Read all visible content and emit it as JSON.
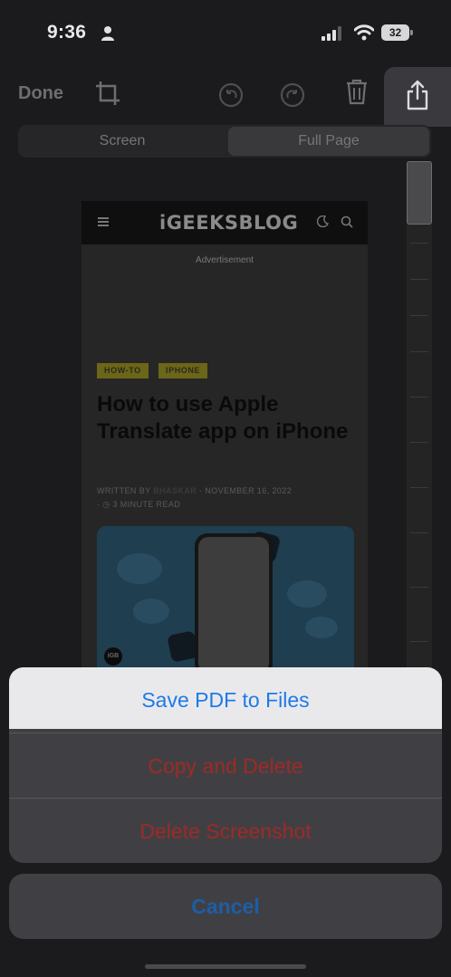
{
  "status_bar": {
    "time": "9:36",
    "battery": "32"
  },
  "toolbar": {
    "done_label": "Done"
  },
  "segments": {
    "screen": "Screen",
    "full_page": "Full Page"
  },
  "article": {
    "logo": "iGEEKSBLOG",
    "advertisement": "Advertisement",
    "tags": [
      "HOW-TO",
      "IPHONE"
    ],
    "headline": "How to use Apple Translate app on iPhone",
    "written_by": "WRITTEN BY",
    "author": "BHASKAR",
    "date": "NOVEMBER 16, 2022",
    "read_time": "3 MINUTE READ",
    "badge": "iGB"
  },
  "action_sheet": {
    "save_pdf": "Save PDF to Files",
    "copy_delete": "Copy and Delete",
    "delete_screenshot": "Delete Screenshot",
    "cancel": "Cancel"
  },
  "colors": {
    "action_blue": "#1f7ae6",
    "destructive_red": "#9e2a26",
    "tag_yellow": "#6b6618"
  }
}
